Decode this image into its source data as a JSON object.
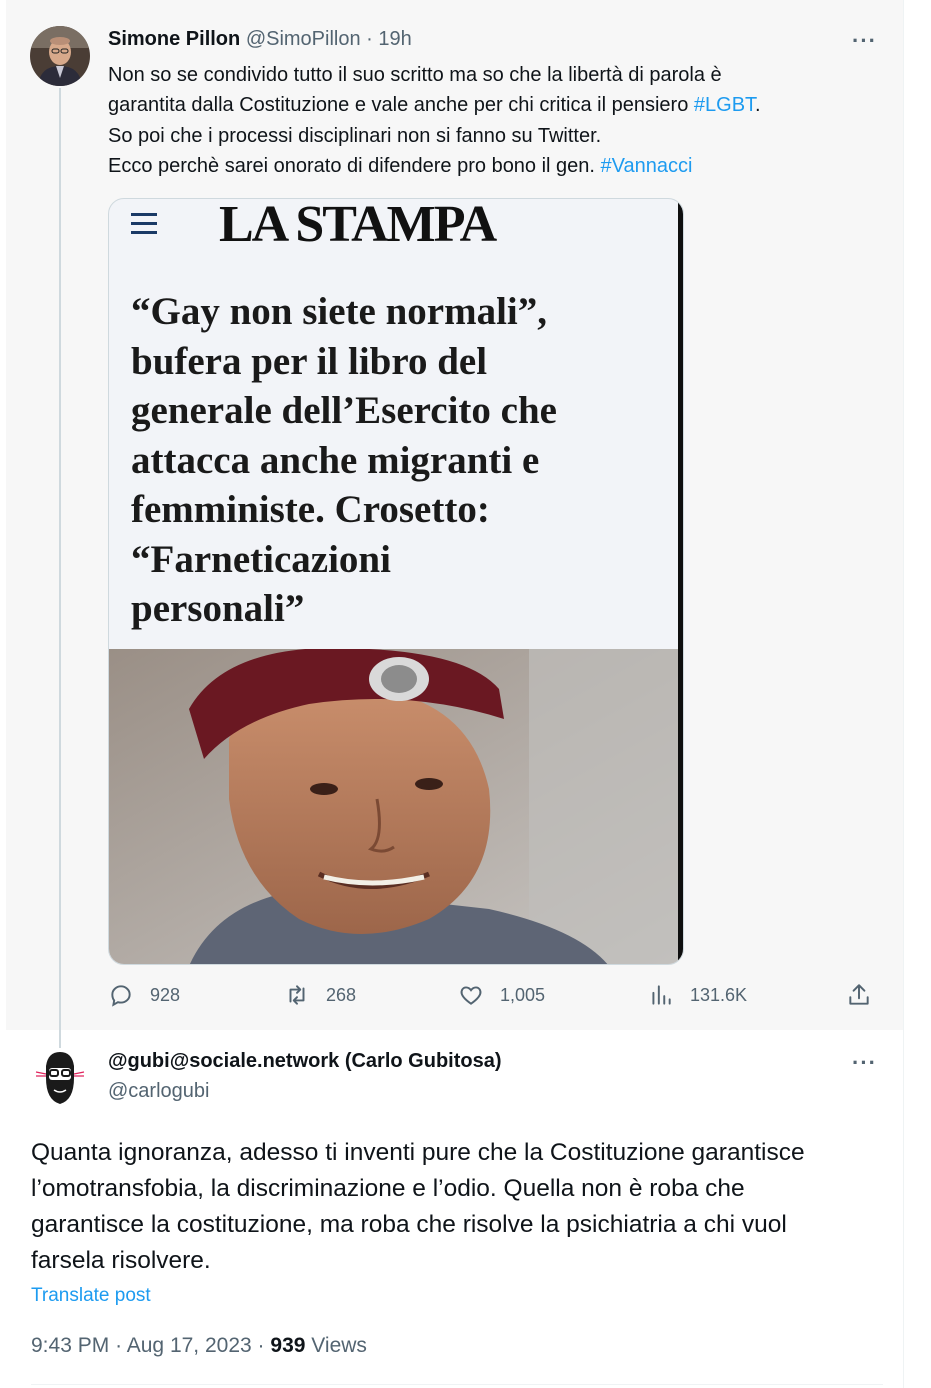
{
  "parent_tweet": {
    "author_name": "Simone Pillon",
    "author_handle": "@SimoPillon",
    "separator": "·",
    "time": "19h",
    "more_label": "···",
    "text_lines": [
      {
        "before": "Non so se condivido tutto il suo scritto ma so che la libertà di parola è",
        "hashtag": "",
        "after": ""
      },
      {
        "before": "garantita dalla Costituzione e vale anche per chi critica il pensiero ",
        "hashtag": "#LGBT",
        "after": "."
      },
      {
        "before": "So poi che i processi disciplinari non si fanno su Twitter.",
        "hashtag": "",
        "after": ""
      },
      {
        "before": "Ecco perchè sarei onorato di difendere pro bono il gen. ",
        "hashtag": "#Vannacci",
        "after": ""
      }
    ],
    "media": {
      "masthead": "LA STAMPA",
      "headline_lines": [
        "“Gay non siete normali”,",
        "bufera per il libro del",
        "generale dell’Esercito che",
        "attacca anche migranti e",
        "femministe. Crosetto:",
        "“Farneticazioni",
        "personali”"
      ]
    },
    "stats": {
      "replies": "928",
      "reposts": "268",
      "likes": "1,005",
      "views": "131.6K"
    },
    "icons": [
      "reply-icon",
      "repost-icon",
      "like-icon",
      "views-icon",
      "share-icon",
      "menu-icon"
    ]
  },
  "reply_tweet": {
    "author_name": "@gubi@sociale.network (Carlo Gubitosa)",
    "author_handle": "@carlogubi",
    "more_label": "···",
    "text_lines": [
      "Quanta ignoranza, adesso ti inventi pure che la Costituzione garantisce",
      "l’omotransfobia, la discriminazione e l’odio. Quella non è roba che",
      "garantisce la costituzione, ma roba che risolve la psichiatria a chi vuol",
      "farsela risolvere."
    ],
    "translate_label": "Translate post",
    "time": "9:43 PM",
    "date": "Aug 17, 2023",
    "separator": "·",
    "views_count": "939",
    "views_label": "Views"
  },
  "colors": {
    "link": "#1d9bf0",
    "secondary_text": "#536471",
    "thread_line": "#cfd9de",
    "parent_bg": "#f7f7f7"
  }
}
